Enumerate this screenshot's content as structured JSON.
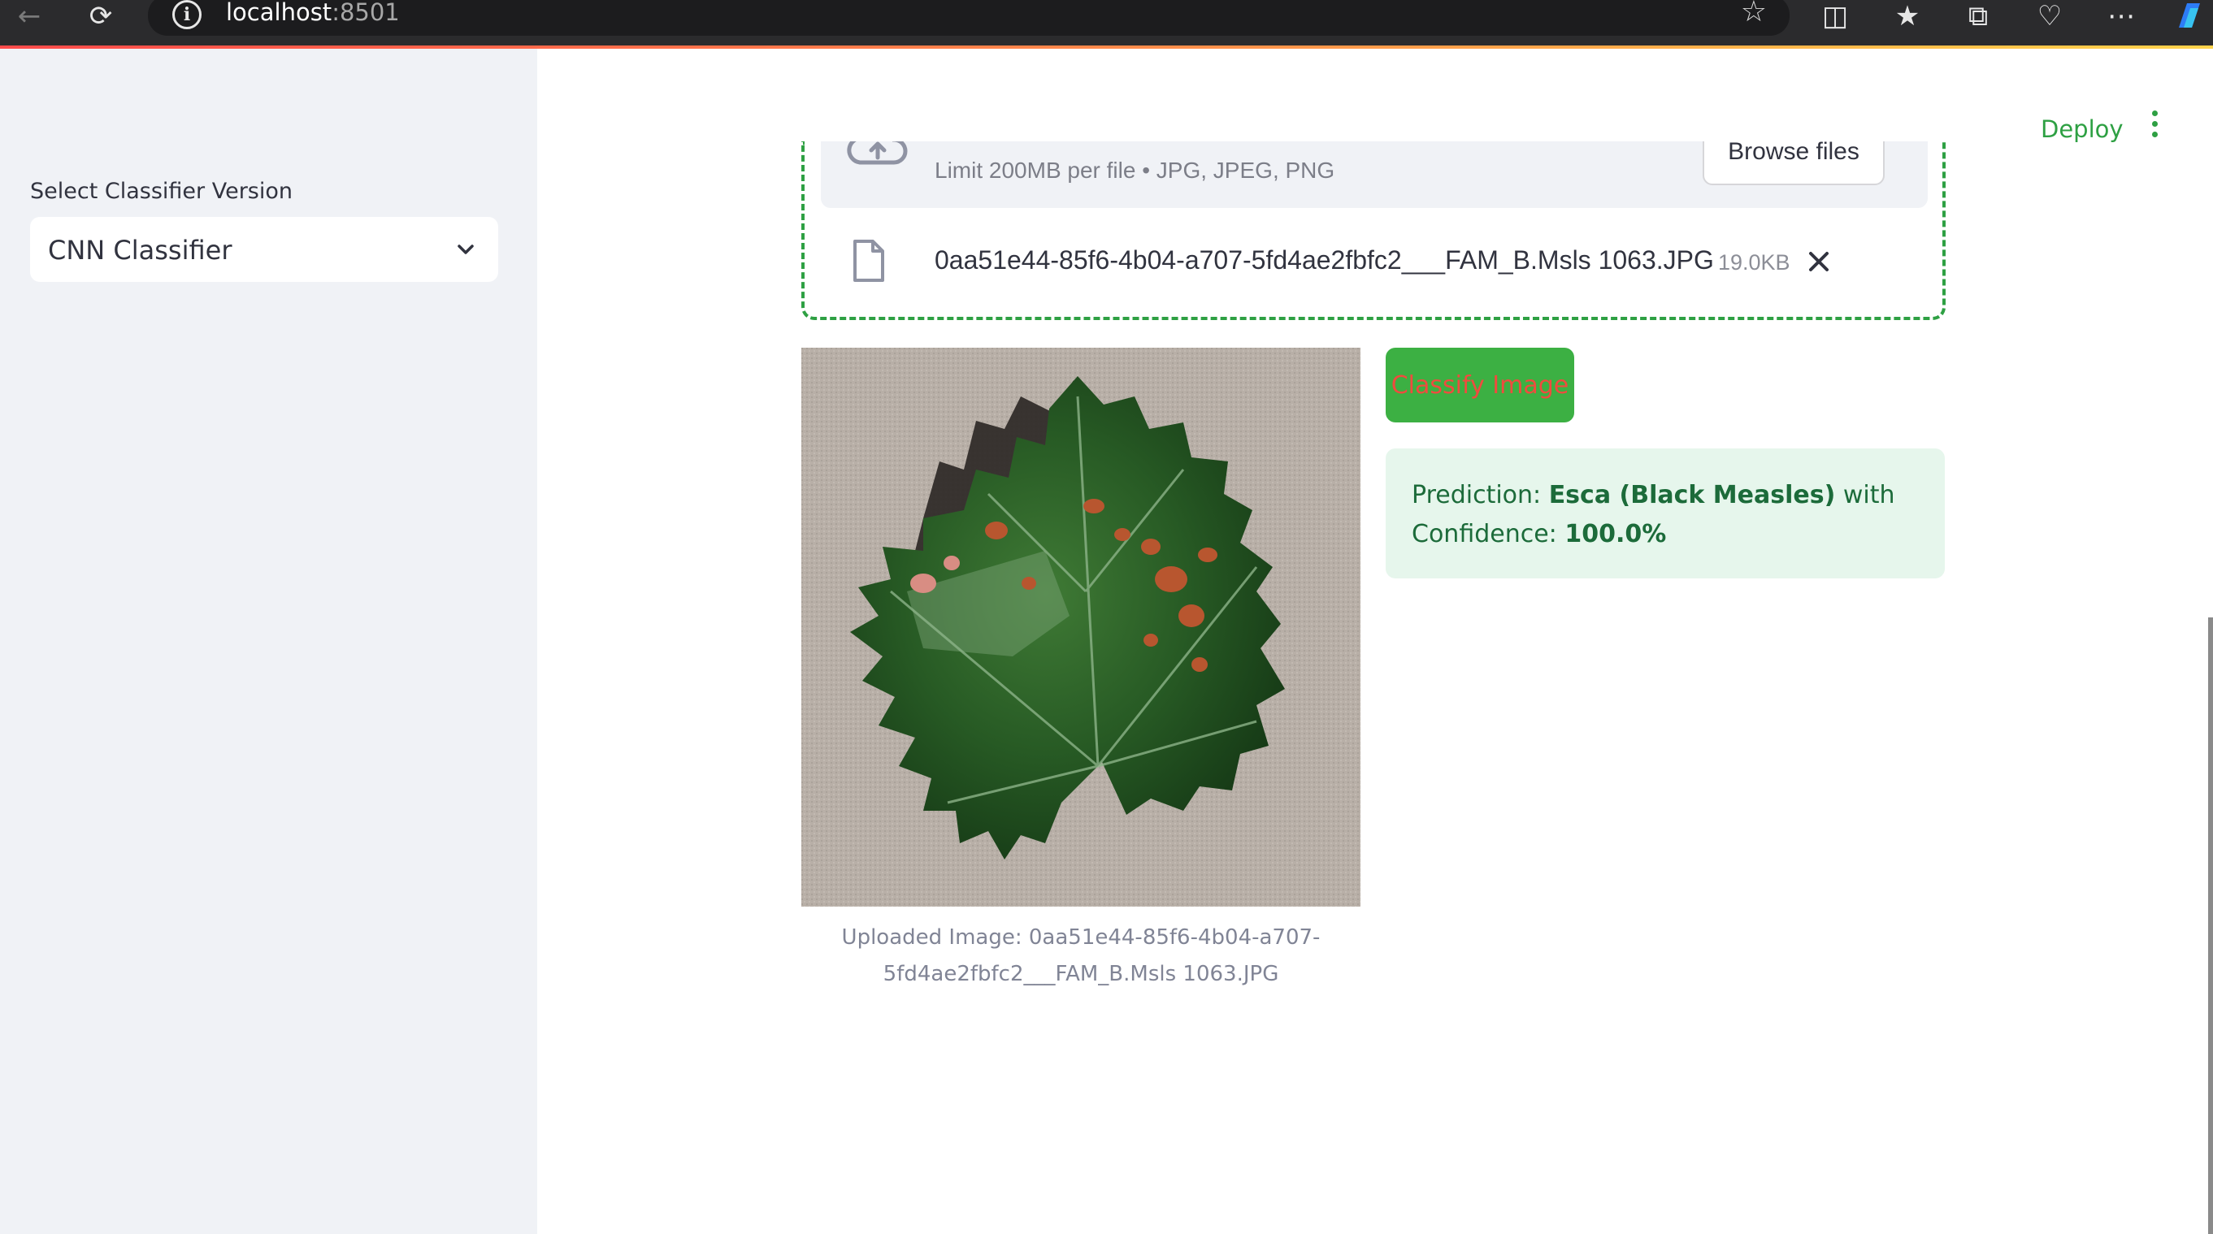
{
  "browser": {
    "url_host": "localhost",
    "url_port": ":8501"
  },
  "sidebar": {
    "classifier_label": "Select Classifier Version",
    "classifier_value": "CNN Classifier"
  },
  "header": {
    "deploy_label": "Deploy"
  },
  "uploader": {
    "limit_text": "Limit 200MB per file • JPG, JPEG, PNG",
    "browse_label": "Browse files",
    "file_name": "0aa51e44-85f6-4b04-a707-5fd4ae2fbfc2___FAM_B.Msls 1063.JPG",
    "file_size": "19.0KB"
  },
  "image": {
    "caption_line1": "Uploaded Image: 0aa51e44-85f6-4b04-a707-",
    "caption_line2": "5fd4ae2fbfc2___FAM_B.Msls 1063.JPG"
  },
  "actions": {
    "classify_label": "Classify Image"
  },
  "prediction": {
    "prefix": "Prediction: ",
    "label": "Esca (Black Measles)",
    "with": " with",
    "confidence_prefix": "Confidence: ",
    "confidence_value": "100.0%"
  },
  "colors": {
    "accent_green": "#2ea043",
    "button_green": "#3cb043",
    "success_bg": "#e6f6ec",
    "sidebar_bg": "#f0f2f6"
  },
  "icons": [
    "back-arrow-icon",
    "refresh-icon",
    "info-icon",
    "star-icon",
    "split-screen-icon",
    "favorites-icon",
    "collections-icon",
    "health-icon",
    "more-icon",
    "copilot-icon",
    "chevron-down-icon",
    "cloud-upload-icon",
    "file-icon",
    "close-icon",
    "kebab-menu-icon"
  ]
}
